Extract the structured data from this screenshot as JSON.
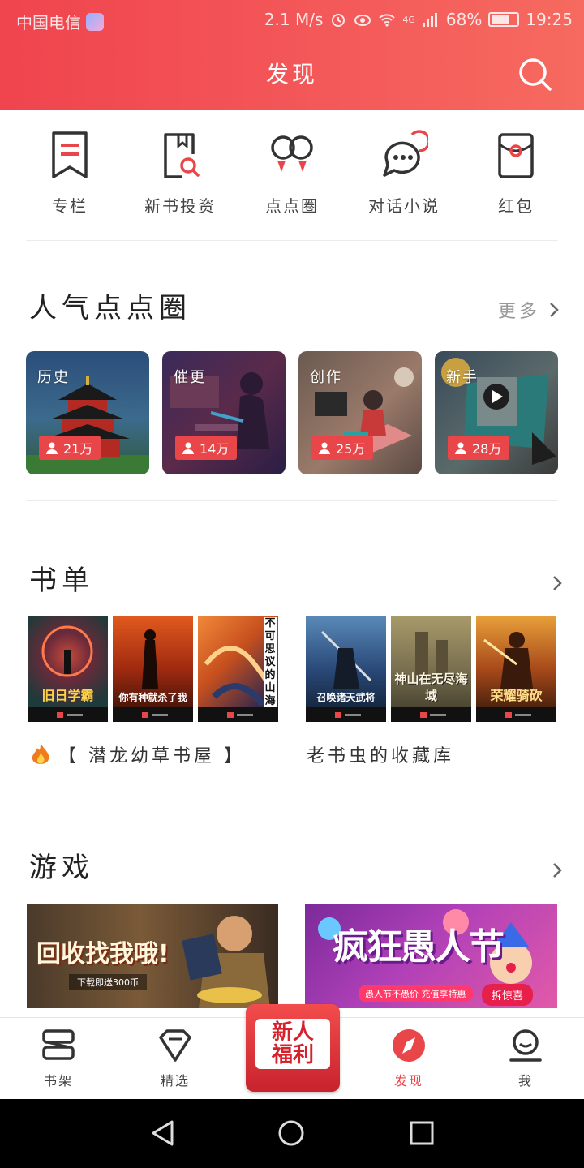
{
  "status_bar": {
    "carrier": "中国电信",
    "speed": "2.1 M/s",
    "network": "4G",
    "battery": "68%",
    "time": "19:25"
  },
  "header": {
    "title": "发现",
    "search_icon": "search-icon"
  },
  "entries": [
    {
      "label": "专栏",
      "icon": "column-icon"
    },
    {
      "label": "新书投资",
      "icon": "book-search-icon"
    },
    {
      "label": "点点圈",
      "icon": "circles-icon"
    },
    {
      "label": "对话小说",
      "icon": "chat-icon"
    },
    {
      "label": "红包",
      "icon": "red-packet-icon"
    }
  ],
  "popular_circles": {
    "title": "人气点点圈",
    "more_label": "更多",
    "cards": [
      {
        "tag": "历史",
        "count": "21万"
      },
      {
        "tag": "催更",
        "count": "14万"
      },
      {
        "tag": "创作",
        "count": "25万"
      },
      {
        "tag": "新手",
        "count": "28万"
      }
    ]
  },
  "booklists": {
    "title": "书单",
    "lists": [
      {
        "name": "【 潜龙幼草书屋 】",
        "books": [
          "旧日学霸",
          "你有种就杀了我",
          "不可思议的山海"
        ]
      },
      {
        "name": "老书虫的收藏库",
        "books": [
          "召唤诸天武将",
          "神山在无尽海域",
          "荣耀骑砍"
        ]
      }
    ]
  },
  "games": {
    "title": "游戏",
    "banners": [
      {
        "headline": "回收找我哦!",
        "sub": "下载即送300币"
      },
      {
        "headline": "疯狂愚人节",
        "sub": "愚人节不愚价 充值享特惠",
        "button": "拆惊喜"
      }
    ]
  },
  "bottom_nav": {
    "items": [
      {
        "label": "书架",
        "icon": "bookshelf-icon"
      },
      {
        "label": "精选",
        "icon": "diamond-icon"
      },
      {
        "label": "发现",
        "icon": "compass-icon",
        "active": true
      },
      {
        "label": "我",
        "icon": "profile-icon"
      }
    ],
    "welfare": {
      "line1": "新人",
      "line2": "福利"
    }
  },
  "colors": {
    "accent": "#e9464a",
    "header_start": "#f0444e",
    "header_end": "#f66a5f"
  }
}
